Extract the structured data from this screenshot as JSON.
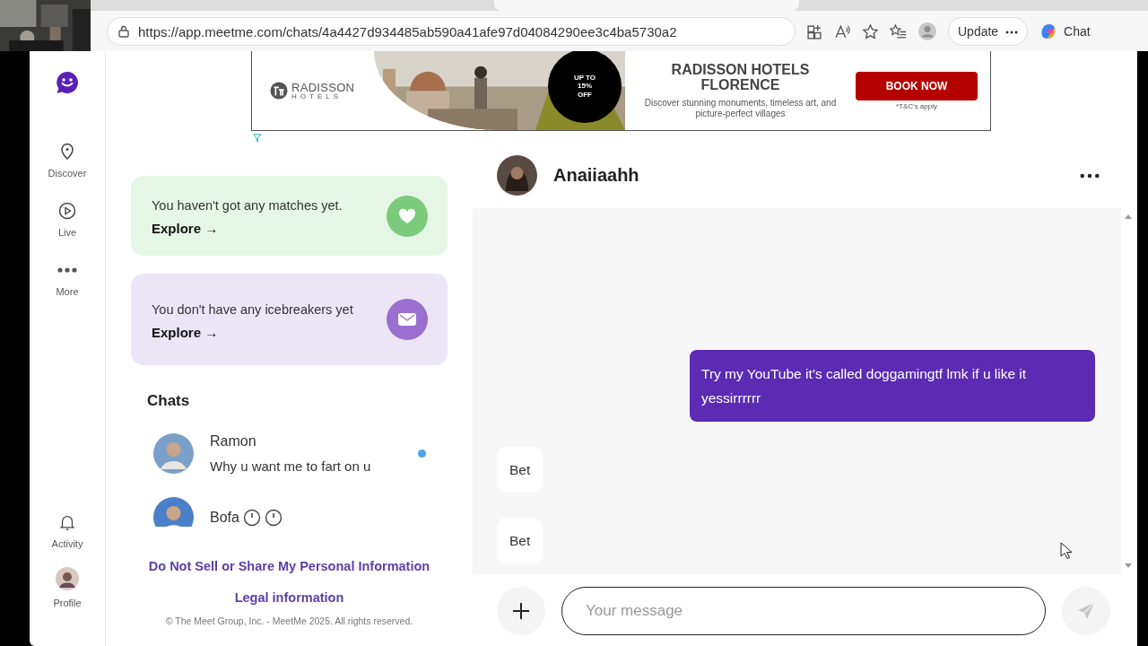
{
  "browser": {
    "url": "https://app.meetme.com/chats/4a4427d934485ab590a41afe97d04084290ee3c4ba5730a2",
    "update_button": "Update",
    "chat_button": "Chat"
  },
  "nav": {
    "top_items": [
      {
        "kind": "logo"
      },
      {
        "kind": "discover",
        "label": "Discover"
      },
      {
        "kind": "live",
        "label": "Live"
      },
      {
        "kind": "more",
        "label": "More"
      }
    ],
    "bottom_items": [
      {
        "kind": "activity",
        "label": "Activity"
      },
      {
        "kind": "profile",
        "label": "Profile"
      }
    ]
  },
  "ad": {
    "brand": "RADISSON",
    "brand_sub": "HOTELS",
    "badge": [
      "UP TO",
      "15%",
      "OFF"
    ],
    "title": "RADISSON HOTELS FLORENCE",
    "text": "Discover stunning monuments, timeless art, and picture-perfect villages",
    "button": "BOOK NOW",
    "note": "*T&C's apply"
  },
  "prompts": [
    {
      "kind": "matches",
      "text": "You haven't got any matches yet.",
      "link": "Explore →"
    },
    {
      "kind": "icebreakers",
      "text": "You don't have any icebreakers yet",
      "link": "Explore →"
    }
  ],
  "chats": {
    "title": "Chats",
    "items": [
      {
        "name": "Ramon",
        "preview": "Why u want me to fart on u",
        "unread": true
      },
      {
        "name": "Bofa",
        "unread": false,
        "icons": [
          {
            "kind": "timer"
          },
          {
            "kind": "timer"
          }
        ]
      }
    ]
  },
  "footer": {
    "links": [
      "Do Not Sell or Share My Personal Information",
      "Legal information"
    ],
    "copyright": "© The Meet Group, Inc. - MeetMe 2025. All rights reserved."
  },
  "conversation": {
    "name": "Anaiiaahh",
    "messages": [
      {
        "kind": "sent",
        "text": "Try my YouTube it’s called doggamingtf lmk if u like it yessirrrrrr"
      },
      {
        "kind": "received",
        "text": "Bet"
      },
      {
        "kind": "received",
        "text": "Bet"
      }
    ],
    "input": {
      "placeholder": "Your message"
    }
  }
}
